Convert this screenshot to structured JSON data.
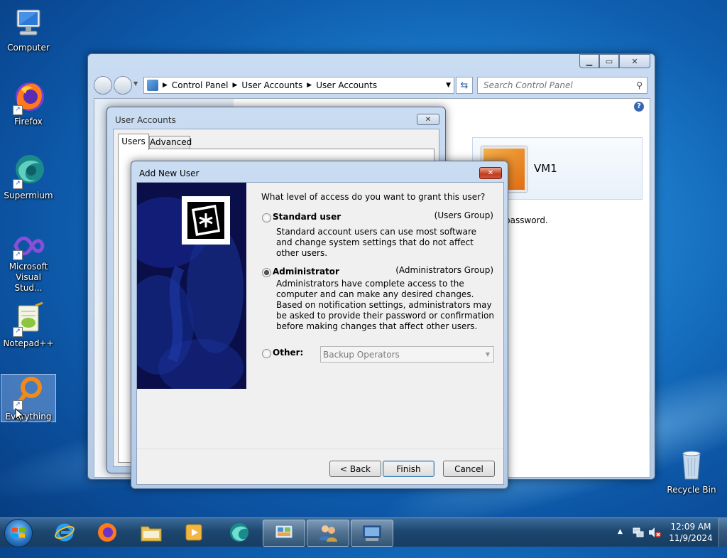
{
  "desktop": {
    "icons": [
      {
        "label": "Computer"
      },
      {
        "label": "Firefox"
      },
      {
        "label": "Supermium"
      },
      {
        "label": "Microsoft Visual Stud..."
      },
      {
        "label": "Notepad++"
      },
      {
        "label": "Everything"
      },
      {
        "label": "Recycle Bin"
      }
    ]
  },
  "explorer": {
    "breadcrumb": [
      "Control Panel",
      "User Accounts",
      "User Accounts"
    ],
    "search_placeholder": "Search Control Panel",
    "account_name": "VM1",
    "partial_text": "password."
  },
  "user_accounts_dialog": {
    "title": "User Accounts",
    "tabs": [
      "Users",
      "Advanced"
    ]
  },
  "add_user_dialog": {
    "title": "Add New User",
    "question": "What level of access do you want to grant this user?",
    "options": [
      {
        "label": "Standard user",
        "group": "(Users Group)",
        "description": "Standard account users can use most software and change system settings that do not affect other users.",
        "selected": false
      },
      {
        "label": "Administrator",
        "group": "(Administrators Group)",
        "description": "Administrators have complete access to the computer and can make any desired changes. Based on notification settings, administrators may be asked to provide their password or confirmation before making changes that affect other users.",
        "selected": true
      },
      {
        "label": "Other:",
        "dropdown_value": "Backup Operators",
        "selected": false
      }
    ],
    "buttons": {
      "back": "< Back",
      "finish": "Finish",
      "cancel": "Cancel"
    }
  },
  "taskbar": {
    "time": "12:09 AM",
    "date": "11/9/2024"
  }
}
